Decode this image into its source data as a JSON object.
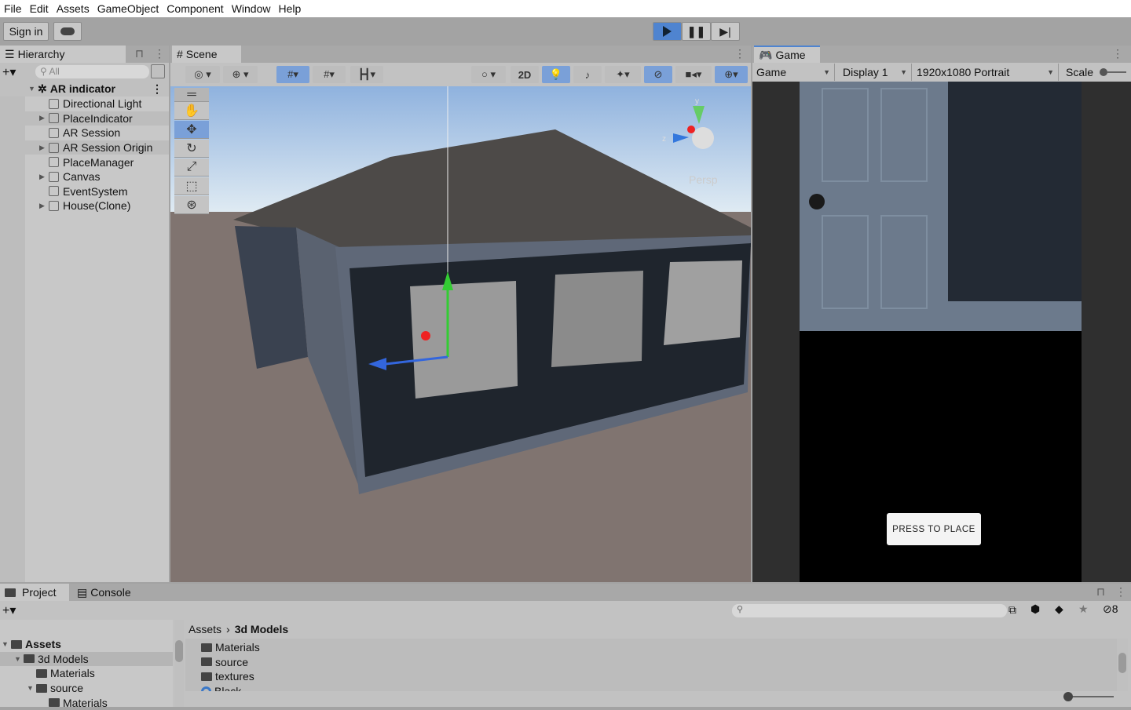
{
  "menu": [
    "File",
    "Edit",
    "Assets",
    "GameObject",
    "Component",
    "Window",
    "Help"
  ],
  "toolbar": {
    "sign_in": "Sign in",
    "cloud_icon": "cloud-icon",
    "play": "play-icon",
    "pause": "pause-icon",
    "step": "step-icon",
    "accent": "#4f84d0"
  },
  "hierarchy": {
    "title": "Hierarchy",
    "search_placeholder": "All",
    "root": "AR indicator",
    "items": [
      {
        "label": "Directional Light",
        "expandable": false
      },
      {
        "label": "PlaceIndicator",
        "expandable": true
      },
      {
        "label": "AR Session",
        "expandable": false
      },
      {
        "label": "AR Session Origin",
        "expandable": true
      },
      {
        "label": "PlaceManager",
        "expandable": false
      },
      {
        "label": "Canvas",
        "expandable": true
      },
      {
        "label": "EventSystem",
        "expandable": false
      },
      {
        "label": "House(Clone)",
        "expandable": true
      }
    ]
  },
  "scene": {
    "title": "Scene",
    "btn_2d": "2D",
    "persp": "Persp",
    "gizmo_axes": {
      "y": "y",
      "z": "z"
    }
  },
  "game": {
    "title": "Game",
    "mode": "Game",
    "display": "Display 1",
    "resolution": "1920x1080 Portrait",
    "scale_label": "Scale",
    "button": "PRESS TO PLACE"
  },
  "project": {
    "tab_project": "Project",
    "tab_console": "Console",
    "breadcrumb": [
      "Assets",
      "3d Models"
    ],
    "hidden_count": "8",
    "tree": [
      {
        "label": "Assets",
        "level": 0,
        "open": true,
        "bold": true
      },
      {
        "label": "3d Models",
        "level": 1,
        "open": true
      },
      {
        "label": "Materials",
        "level": 2
      },
      {
        "label": "source",
        "level": 2,
        "open": true
      },
      {
        "label": "Materials",
        "level": 3
      }
    ],
    "files": [
      "Materials",
      "source",
      "textures",
      "Black"
    ]
  }
}
